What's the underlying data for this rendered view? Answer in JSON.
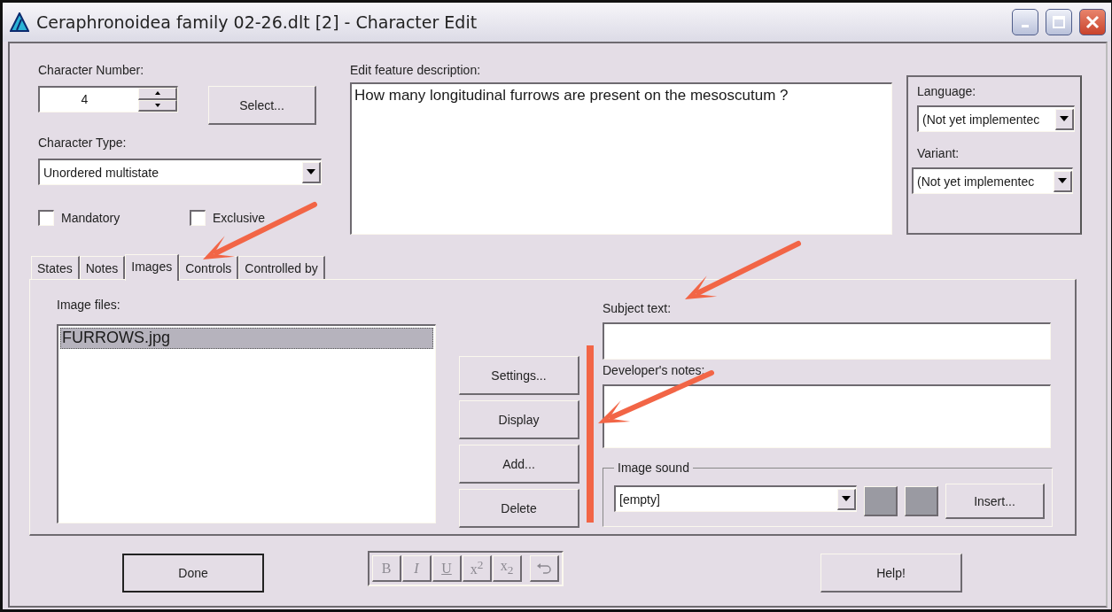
{
  "window": {
    "title": "Ceraphronoidea family 02-26.dlt [2] - Character Edit"
  },
  "character_number": {
    "label": "Character Number:",
    "value": "4"
  },
  "select_button": "Select...",
  "character_type": {
    "label": "Character Type:",
    "value": "Unordered multistate"
  },
  "checkboxes": [
    {
      "label": "Mandatory",
      "checked": false
    },
    {
      "label": "Exclusive",
      "checked": false
    }
  ],
  "description": {
    "label": "Edit feature description:",
    "value": "How many longitudinal furrows are present on the mesoscutum ?"
  },
  "language": {
    "label": "Language:",
    "value": "(Not yet implementec"
  },
  "variant": {
    "label": "Variant:",
    "value": "(Not yet implementec"
  },
  "tabs": [
    {
      "label": "States",
      "selected": false
    },
    {
      "label": "Notes",
      "selected": false
    },
    {
      "label": "Images",
      "selected": true
    },
    {
      "label": "Controls",
      "selected": false
    },
    {
      "label": "Controlled by",
      "selected": false
    }
  ],
  "image_files": {
    "label": "Image files:",
    "items": [
      {
        "name": "FURROWS.jpg",
        "selected": true
      }
    ]
  },
  "image_buttons": [
    "Settings...",
    "Display",
    "Add...",
    "Delete"
  ],
  "subject_text": {
    "label": "Subject text:"
  },
  "developer_notes": {
    "label": "Developer's notes:"
  },
  "image_sound": {
    "label": "Image sound",
    "value": "[empty]",
    "insert_button": "Insert..."
  },
  "format_buttons": [
    {
      "kind": "bold",
      "label": "B",
      "disabled": true
    },
    {
      "kind": "italic",
      "label": "I",
      "disabled": true
    },
    {
      "kind": "underline",
      "label": "U",
      "disabled": true
    },
    {
      "kind": "superscript",
      "label": "x$^{2}$",
      "disabled": true
    },
    {
      "kind": "subscript",
      "label": "x$_{2}$",
      "disabled": true
    },
    {
      "kind": "undo",
      "disabled": true
    }
  ],
  "done_button": "Done",
  "help_button": "Help!"
}
